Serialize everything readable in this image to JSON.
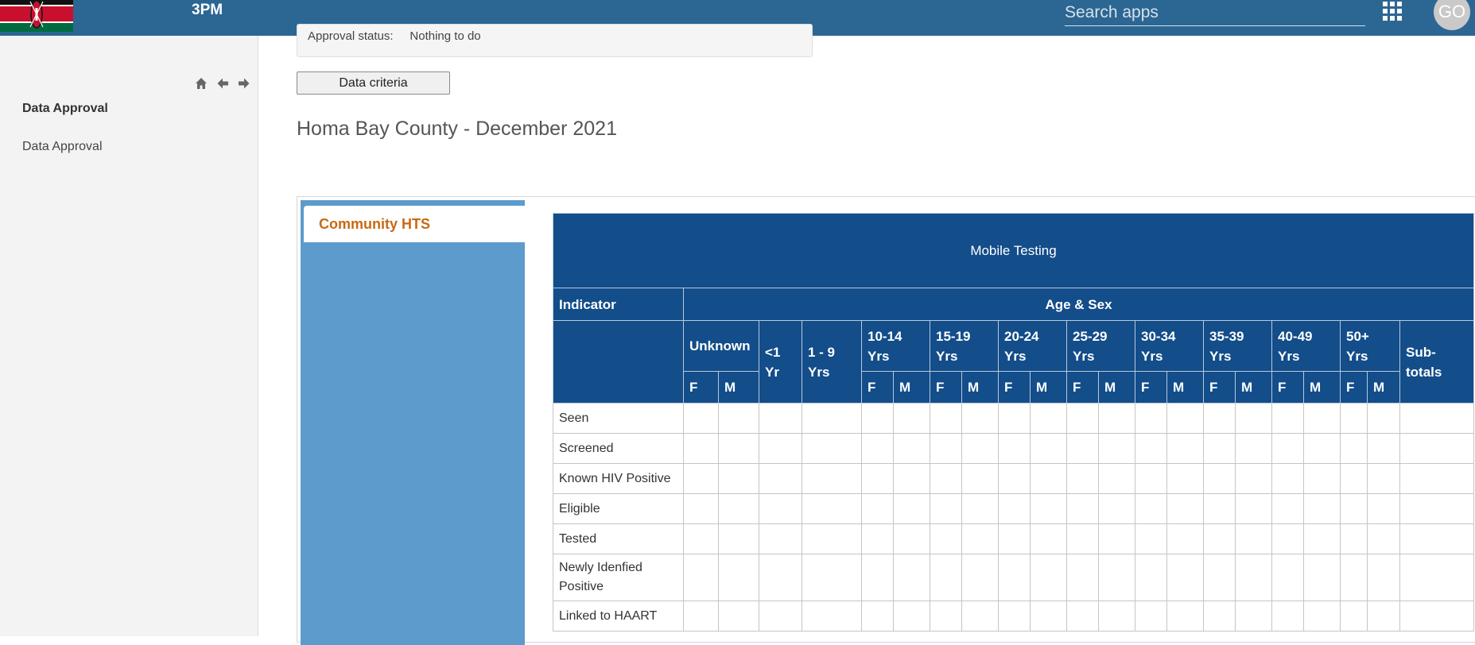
{
  "header": {
    "app_name": "3PM",
    "search_placeholder": "Search apps",
    "user_initials": "GO"
  },
  "sidebar": {
    "title": "Data Approval",
    "items": [
      {
        "label": "Data Approval"
      }
    ]
  },
  "approval": {
    "status_label": "Approval status:",
    "status_value": "Nothing to do"
  },
  "data_criteria_button": "Data criteria",
  "report_title": "Homa Bay County - December 2021",
  "tabs": [
    {
      "label": "Community HTS",
      "active": true
    }
  ],
  "table": {
    "title": "Mobile Testing",
    "indicator_header": "Indicator",
    "age_sex_header": "Age & Sex",
    "age_groups": [
      {
        "label": "Unknown"
      },
      {
        "label": "<1 Yr"
      },
      {
        "label": "1 - 9 Yrs"
      },
      {
        "label": "10-14 Yrs"
      },
      {
        "label": "15-19 Yrs"
      },
      {
        "label": "20-24 Yrs"
      },
      {
        "label": "25-29 Yrs"
      },
      {
        "label": "30-34 Yrs"
      },
      {
        "label": "35-39 Yrs"
      },
      {
        "label": "40-49 Yrs"
      },
      {
        "label": "50+ Yrs"
      }
    ],
    "subtotals_header": "Sub-totals",
    "sex_labels": {
      "female": "F",
      "male": "M"
    },
    "rows": [
      {
        "label": "Seen"
      },
      {
        "label": "Screened"
      },
      {
        "label": "Known HIV Positive"
      },
      {
        "label": "Eligible"
      },
      {
        "label": "Tested"
      },
      {
        "label": "Newly Idenfied Positive"
      },
      {
        "label": "Linked to HAART"
      }
    ]
  },
  "colors": {
    "topbar": "#2c6693",
    "table_header": "#134d8a",
    "tab_panel": "#5d9bcc",
    "tab_label": "#c86a12"
  },
  "icons": [
    "kenya-flag-icon",
    "apps-grid-icon",
    "home-icon",
    "arrow-left-icon",
    "arrow-right-icon"
  ]
}
